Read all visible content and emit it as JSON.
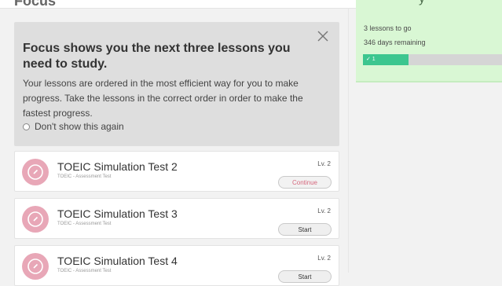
{
  "header": {
    "cut_title": "Focus"
  },
  "focus_box": {
    "title": "Focus shows you the next three lessons you need to study.",
    "body": "Your lessons are ordered in the most efficient way for you to make progress. Take the lessons in the correct order in order to make the fastest progress.",
    "dont_show_label": "Don't show this again"
  },
  "lessons": [
    {
      "title": "TOEIC Simulation Test 2",
      "subtitle": "TOEIC - Assessment Test",
      "level": "Lv. 2",
      "button": "Continue"
    },
    {
      "title": "TOEIC Simulation Test 3",
      "subtitle": "TOEIC - Assessment Test",
      "level": "Lv. 2",
      "button": "Start"
    },
    {
      "title": "TOEIC Simulation Test 4",
      "subtitle": "TOEIC - Assessment Test",
      "level": "Lv. 2",
      "button": "Start"
    }
  ],
  "progress": {
    "cut_title": "y",
    "lessons_to_go": "3 lessons to go",
    "days_remaining": "346 days remaining",
    "completed_label": "✓ 1",
    "completed_fraction": 0.33
  },
  "colors": {
    "accent_pink": "#e8a7b7",
    "progress_green": "#3cc68f",
    "panel_green": "#d9f7d4"
  },
  "icons": {
    "close": "close-icon",
    "lesson": "compass-icon",
    "checkbox": "checkbox-icon"
  }
}
